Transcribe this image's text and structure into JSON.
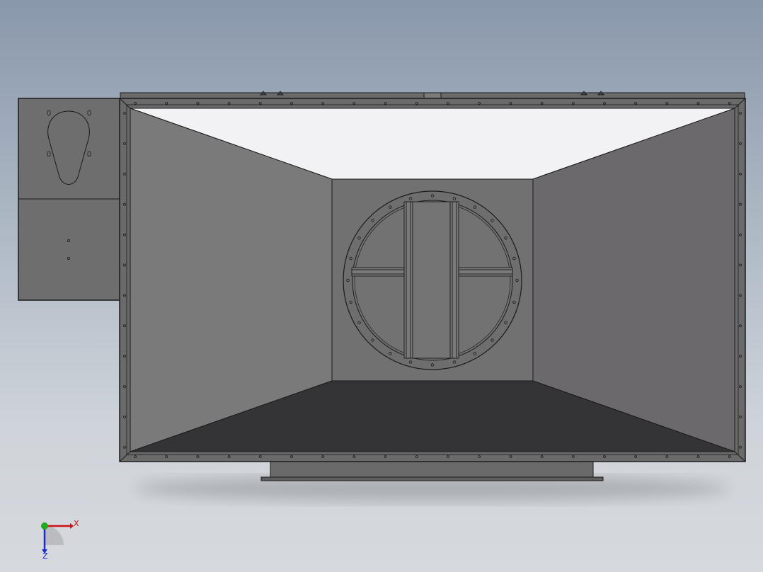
{
  "viewport": {
    "background_top": "#8a98ac",
    "background_bottom": "#d6d9dd"
  },
  "model": {
    "outline_color": "#1a1a1a",
    "left_wall_color": "#7a7a7a",
    "right_wall_color": "#6b696c",
    "top_wall_color": "#f2f2f4",
    "bottom_wall_color": "#343436",
    "back_wall_color": "#717171",
    "frame_color": "#6a6a6a",
    "side_box_color": "#6e6e6e"
  },
  "triad": {
    "x_label": "X",
    "z_label": "Z",
    "x_color": "#cc1111",
    "y_color": "#22aa22",
    "z_color": "#1a2acc"
  }
}
